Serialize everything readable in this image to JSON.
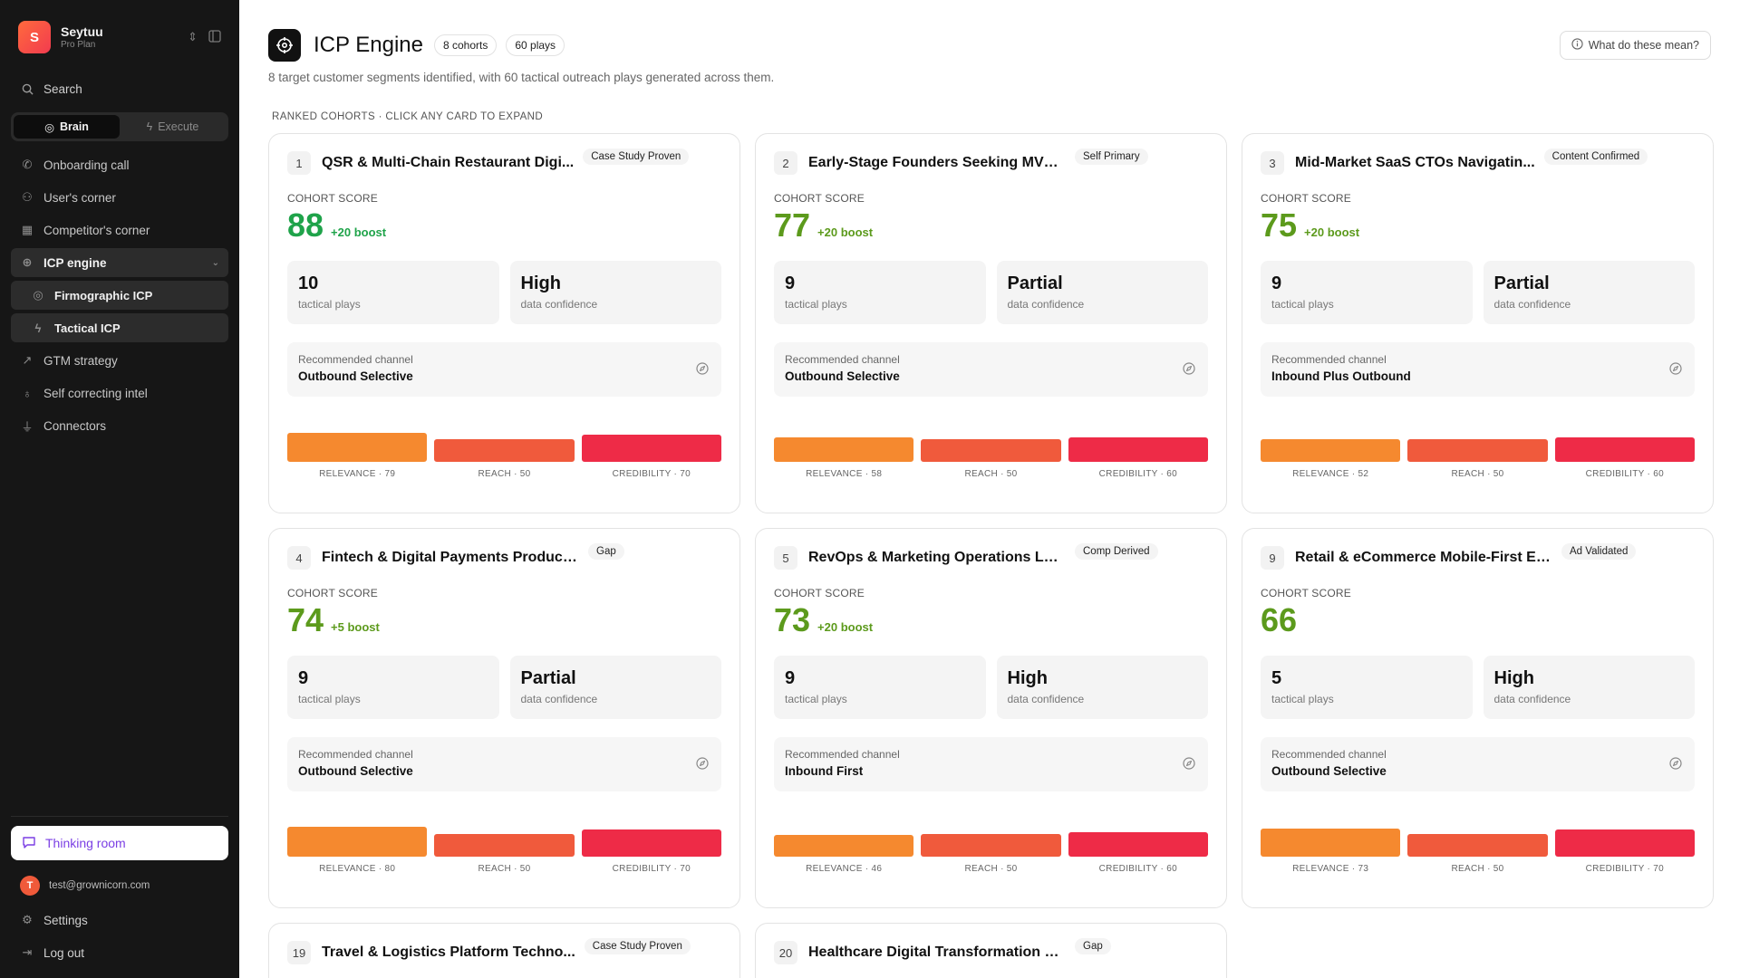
{
  "sidebar": {
    "brand_letter": "S",
    "brand_name": "Seytuu",
    "brand_plan": "Pro Plan",
    "search_label": "Search",
    "mode_brain": "Brain",
    "mode_execute": "Execute",
    "nav": {
      "onboarding": "Onboarding call",
      "users_corner": "User's corner",
      "competitors_corner": "Competitor's corner",
      "icp_engine": "ICP engine",
      "firmographic": "Firmographic ICP",
      "tactical": "Tactical ICP",
      "gtm": "GTM strategy",
      "self_correcting": "Self correcting intel",
      "connectors": "Connectors"
    },
    "thinking_room": "Thinking room",
    "user_initial": "T",
    "user_email": "test@grownicorn.com",
    "settings": "Settings",
    "logout": "Log out"
  },
  "header": {
    "title": "ICP Engine",
    "cohorts_pill": "8 cohorts",
    "plays_pill": "60 plays",
    "help_label": "What do these mean?",
    "subtitle": "8 target customer segments identified, with 60 tactical outreach plays generated across them.",
    "section_label": "RANKED COHORTS · CLICK ANY CARD TO EXPAND"
  },
  "labels": {
    "cohort_score": "COHORT SCORE",
    "tactical_plays": "tactical plays",
    "data_confidence": "data confidence",
    "recommended_channel": "Recommended channel"
  },
  "colors": {
    "relevance": "#f5892f",
    "reach": "#f05a3c",
    "credibility": "#ee2b47",
    "score_green": "#1fa34a",
    "score_olive": "#5c9a1c"
  },
  "cards": [
    {
      "rank": "1",
      "title": "QSR & Multi-Chain Restaurant Digi...",
      "badge": "Case Study Proven",
      "score": "88",
      "boost": "+20 boost",
      "score_color": "#1fa34a",
      "plays": "10",
      "confidence": "High",
      "channel": "Outbound Selective",
      "relevance": 79,
      "reach": 50,
      "credibility": 70,
      "relevance_label": "RELEVANCE · 79",
      "reach_label": "REACH · 50",
      "credibility_label": "CREDIBILITY · 70"
    },
    {
      "rank": "2",
      "title": "Early-Stage Founders Seeking MVP & P...",
      "badge": "Self Primary",
      "score": "77",
      "boost": "+20 boost",
      "score_color": "#5c9a1c",
      "plays": "9",
      "confidence": "Partial",
      "channel": "Outbound Selective",
      "relevance": 58,
      "reach": 50,
      "credibility": 60,
      "relevance_label": "RELEVANCE · 58",
      "reach_label": "REACH · 50",
      "credibility_label": "CREDIBILITY · 60"
    },
    {
      "rank": "3",
      "title": "Mid-Market SaaS CTOs Navigatin...",
      "badge": "Content Confirmed",
      "score": "75",
      "boost": "+20 boost",
      "score_color": "#5c9a1c",
      "plays": "9",
      "confidence": "Partial",
      "channel": "Inbound Plus Outbound",
      "relevance": 52,
      "reach": 50,
      "credibility": 60,
      "relevance_label": "RELEVANCE · 52",
      "reach_label": "REACH · 50",
      "credibility_label": "CREDIBILITY · 60"
    },
    {
      "rank": "4",
      "title": "Fintech & Digital Payments Product Leaders",
      "badge": "Gap",
      "score": "74",
      "boost": "+5 boost",
      "score_color": "#5c9a1c",
      "plays": "9",
      "confidence": "Partial",
      "channel": "Outbound Selective",
      "relevance": 80,
      "reach": 50,
      "credibility": 70,
      "relevance_label": "RELEVANCE · 80",
      "reach_label": "REACH · 50",
      "credibility_label": "CREDIBILITY · 70"
    },
    {
      "rank": "5",
      "title": "RevOps & Marketing Operations Lead...",
      "badge": "Comp Derived",
      "score": "73",
      "boost": "+20 boost",
      "score_color": "#5c9a1c",
      "plays": "9",
      "confidence": "High",
      "channel": "Inbound First",
      "relevance": 46,
      "reach": 50,
      "credibility": 60,
      "relevance_label": "RELEVANCE · 46",
      "reach_label": "REACH · 50",
      "credibility_label": "CREDIBILITY · 60"
    },
    {
      "rank": "9",
      "title": "Retail & eCommerce Mobile-First Expa...",
      "badge": "Ad Validated",
      "score": "66",
      "boost": "",
      "score_color": "#5c9a1c",
      "plays": "5",
      "confidence": "High",
      "channel": "Outbound Selective",
      "relevance": 73,
      "reach": 50,
      "credibility": 70,
      "relevance_label": "RELEVANCE · 73",
      "reach_label": "REACH · 50",
      "credibility_label": "CREDIBILITY · 70"
    }
  ],
  "partial_cards": [
    {
      "rank": "19",
      "title": "Travel & Logistics Platform Techno...",
      "badge": "Case Study Proven"
    },
    {
      "rank": "20",
      "title": "Healthcare Digital Transformation Technolog...",
      "badge": "Gap"
    }
  ]
}
